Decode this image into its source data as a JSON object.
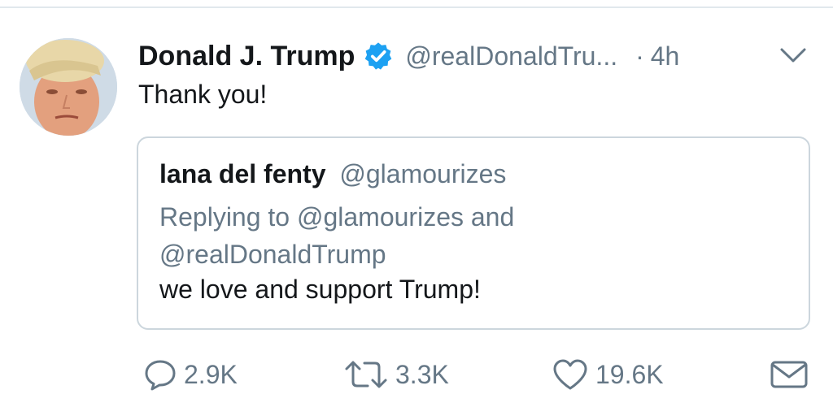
{
  "tweet": {
    "author": {
      "display_name": "Donald J. Trump",
      "handle": "@realDonaldTru...",
      "verified": true,
      "avatar": "profile-photo"
    },
    "separator": "·",
    "time": "4h",
    "menu_icon": "chevron-down-icon",
    "text": "Thank you!"
  },
  "quoted_tweet": {
    "author_name": "lana del fenty",
    "author_handle": "@glamourizes",
    "replying_to": "Replying to @glamourizes and @realDonaldTrump",
    "text": "we love and support Trump!"
  },
  "actions": {
    "reply": {
      "icon": "reply-icon",
      "count": "2.9K"
    },
    "retweet": {
      "icon": "retweet-icon",
      "count": "3.3K"
    },
    "like": {
      "icon": "heart-icon",
      "count": "19.6K"
    },
    "message": {
      "icon": "envelope-icon"
    }
  },
  "colors": {
    "primary_text": "#14171a",
    "secondary_text": "#657786",
    "verified_blue": "#1da1f2",
    "border": "#ccd6dd"
  }
}
